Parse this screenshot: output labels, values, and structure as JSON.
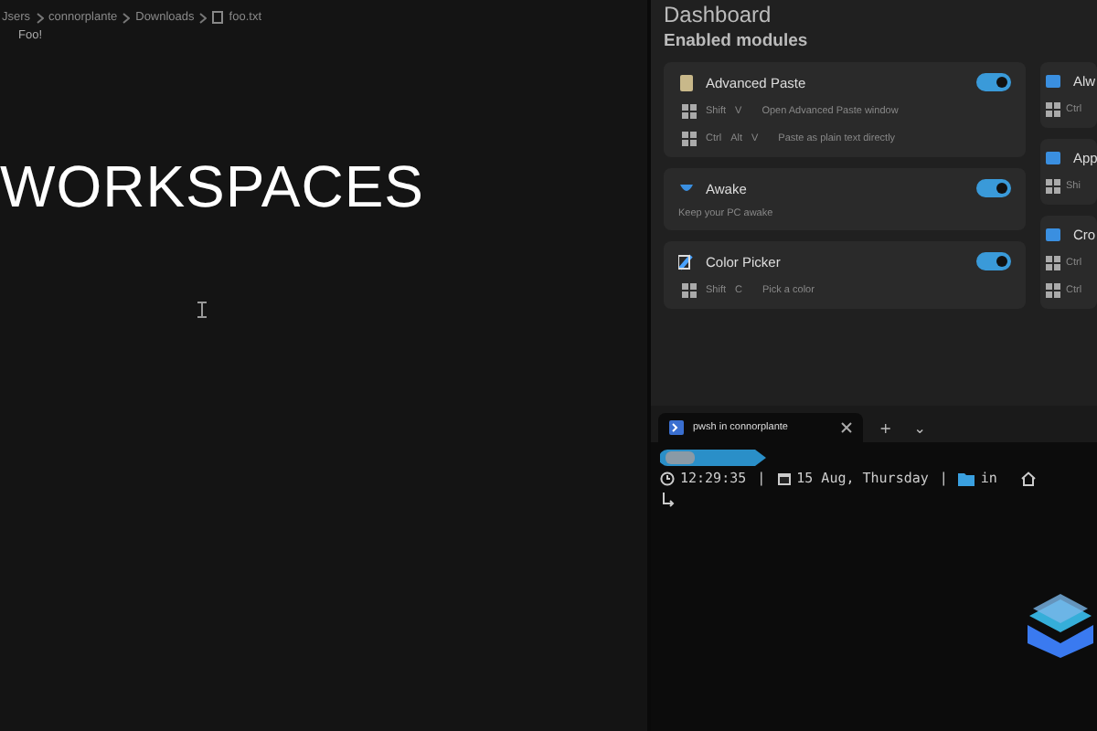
{
  "editor": {
    "breadcrumb": [
      "Jsers",
      "connorplante",
      "Downloads",
      "foo.txt"
    ],
    "lines": [
      "Foo!"
    ],
    "heading": "WORKSPACES"
  },
  "dashboard": {
    "title": "Dashboard",
    "section": "Enabled modules",
    "modules": [
      {
        "name": "Advanced Paste",
        "on": true,
        "shortcuts": [
          {
            "keys": [
              "Shift",
              "V"
            ],
            "action": "Open Advanced Paste window"
          },
          {
            "keys": [
              "Ctrl",
              "Alt",
              "V"
            ],
            "action": "Paste as plain text directly"
          }
        ]
      },
      {
        "name": "Awake",
        "on": true,
        "description": "Keep your PC awake"
      },
      {
        "name": "Color Picker",
        "on": true,
        "shortcuts": [
          {
            "keys": [
              "Shift",
              "C"
            ],
            "action": "Pick a color"
          }
        ]
      }
    ],
    "side_modules": [
      {
        "name": "Alw",
        "keys": [
          "Ctrl"
        ]
      },
      {
        "name": "App",
        "keys": [
          "Shi"
        ]
      },
      {
        "name": "Cro",
        "keys": [
          "Ctrl",
          "Ctrl"
        ]
      }
    ]
  },
  "terminal": {
    "tab": {
      "title": "pwsh in connorplante",
      "selected": true
    },
    "new_tab": "+",
    "dropdown": "⌄",
    "prompt": {
      "time": "12:29:35",
      "separator": "|",
      "date": "15 Aug, Thursday",
      "location": "in"
    }
  }
}
